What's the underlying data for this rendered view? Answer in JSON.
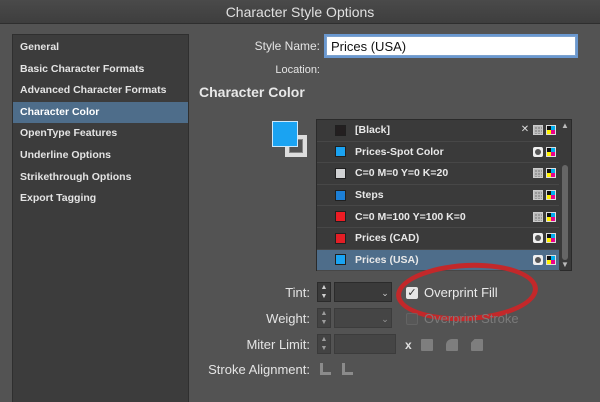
{
  "window": {
    "title": "Character Style Options"
  },
  "sidebar": {
    "items": [
      {
        "label": "General"
      },
      {
        "label": "Basic Character Formats"
      },
      {
        "label": "Advanced Character Formats"
      },
      {
        "label": "Character Color",
        "selected": true
      },
      {
        "label": "OpenType Features"
      },
      {
        "label": "Underline Options"
      },
      {
        "label": "Strikethrough Options"
      },
      {
        "label": "Export Tagging"
      }
    ]
  },
  "form": {
    "style_name_label": "Style Name:",
    "style_name_value": "Prices (USA)",
    "location_label": "Location:"
  },
  "section": {
    "heading": "Character Color"
  },
  "swatches": [
    {
      "name": "[Black]",
      "color": "#231f20",
      "icons": [
        "no-edit-icon",
        "process-icon",
        "cmyk-icon"
      ]
    },
    {
      "name": "Prices-Spot Color",
      "color": "#1aa3f2",
      "icons": [
        "spot-icon",
        "cmyk-icon"
      ]
    },
    {
      "name": "C=0 M=0 Y=0 K=20",
      "color": "#d1d2d4",
      "icons": [
        "process-icon",
        "cmyk-icon"
      ]
    },
    {
      "name": "Steps",
      "color": "#1c7fd6",
      "icons": [
        "process-icon",
        "cmyk-icon"
      ]
    },
    {
      "name": "C=0 M=100 Y=100 K=0",
      "color": "#ed1c24",
      "icons": [
        "process-icon",
        "cmyk-icon"
      ]
    },
    {
      "name": "Prices (CAD)",
      "color": "#e31e25",
      "icons": [
        "spot-icon",
        "cmyk-icon"
      ]
    },
    {
      "name": "Prices (USA)",
      "color": "#1aa3f2",
      "icons": [
        "spot-icon",
        "cmyk-icon"
      ],
      "selected": true
    }
  ],
  "controls": {
    "tint_label": "Tint:",
    "tint_value": "",
    "overprint_fill_label": "Overprint Fill",
    "overprint_fill_checked": true,
    "weight_label": "Weight:",
    "weight_value": "",
    "overprint_stroke_label": "Overprint Stroke",
    "overprint_stroke_checked": false,
    "miter_limit_label": "Miter Limit:",
    "miter_value": "",
    "miter_x": "x",
    "stroke_alignment_label": "Stroke Alignment:"
  },
  "colors": {
    "fill_proxy": "#1aa3f2",
    "selection": "#4e6d8a",
    "highlight_ring": "#c3282a"
  }
}
